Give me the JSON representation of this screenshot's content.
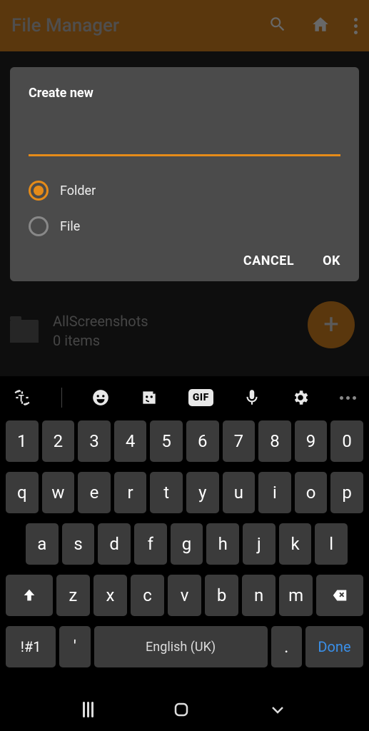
{
  "topbar": {
    "title": "File Manager"
  },
  "list": {
    "item_name": "AllScreenshots",
    "item_sub": "0 items"
  },
  "dialog": {
    "title": "Create new",
    "input_value": "",
    "radio_folder": "Folder",
    "radio_file": "File",
    "cancel": "CANCEL",
    "ok": "OK"
  },
  "keyboard": {
    "row0": [
      "1",
      "2",
      "3",
      "4",
      "5",
      "6",
      "7",
      "8",
      "9",
      "0"
    ],
    "row1": [
      "q",
      "w",
      "e",
      "r",
      "t",
      "y",
      "u",
      "i",
      "o",
      "p"
    ],
    "row2": [
      "a",
      "s",
      "d",
      "f",
      "g",
      "h",
      "j",
      "k",
      "l"
    ],
    "row3": [
      "z",
      "x",
      "c",
      "v",
      "b",
      "n",
      "m"
    ],
    "sym": "!#1",
    "apos": "'",
    "dot": ".",
    "space_label": "English (UK)",
    "done": "Done",
    "gif": "GIF"
  }
}
